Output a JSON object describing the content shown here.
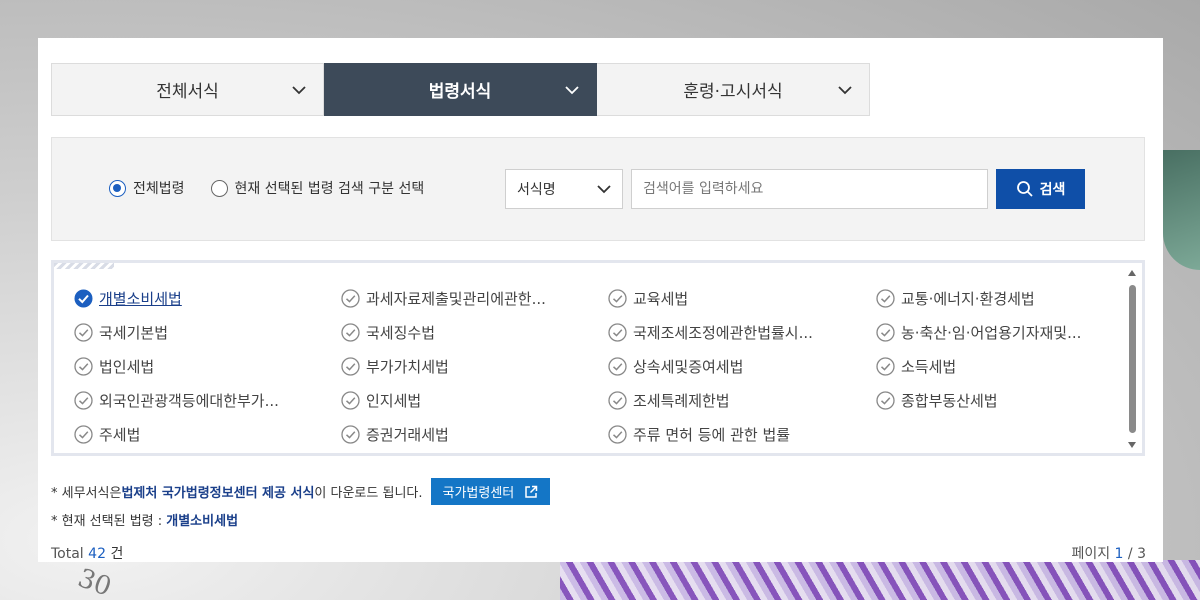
{
  "tabs": [
    {
      "label": "전체서식",
      "active": false
    },
    {
      "label": "법령서식",
      "active": true
    },
    {
      "label": "훈령·고시서식",
      "active": false
    }
  ],
  "search": {
    "radio_all": "전체법령",
    "radio_selected": "현재 선택된 법령 검색 구분 선택",
    "select_value": "서식명",
    "placeholder": "검색어를 입력하세요",
    "button_label": "검색"
  },
  "laws": [
    "개별소비세법",
    "과세자료제출및관리에관한...",
    "교육세법",
    "교통·에너지·환경세법",
    "국세기본법",
    "국세징수법",
    "국제조세조정에관한법률시...",
    "농·축산·임·어업용기자재및...",
    "법인세법",
    "부가가치세법",
    "상속세및증여세법",
    "소득세법",
    "외국인관광객등에대한부가...",
    "인지세법",
    "조세특례제한법",
    "종합부동산세법",
    "주세법",
    "증권거래세법",
    "주류 면허 등에 관한 법률"
  ],
  "notes": {
    "line1_prefix": "* 세무서식은 ",
    "line1_strong": "법제처 국가법령정보센터 제공 서식",
    "line1_suffix": "이 다운로드 됩니다.",
    "center_button": "국가법령센터",
    "line2_prefix": "* 현재 선택된 법령 : ",
    "line2_strong": "개별소비세법"
  },
  "footer": {
    "total_label": "Total",
    "total_count": "42",
    "total_unit": "건",
    "page_label": "페이지",
    "page_current": "1",
    "page_sep": "/",
    "page_total": "3"
  },
  "colors": {
    "tab_active": "#3d4a59",
    "primary_button": "#0f4fa8",
    "link_button": "#1476c6",
    "accent": "#1c5fc0"
  }
}
